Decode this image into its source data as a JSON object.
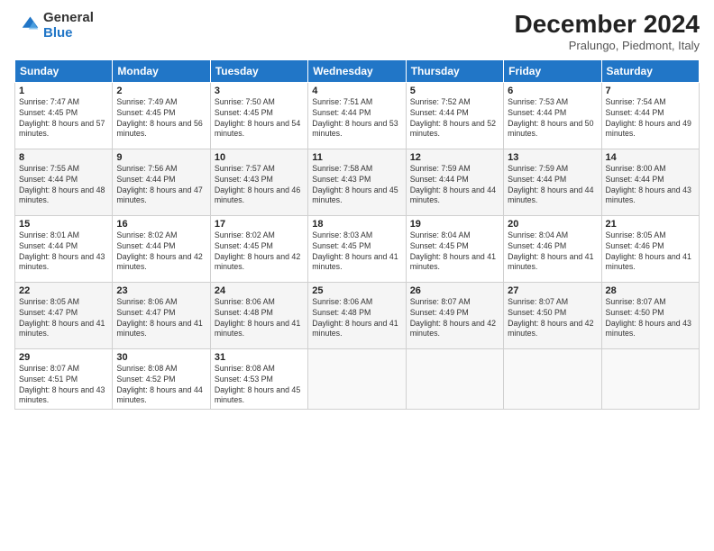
{
  "logo": {
    "general": "General",
    "blue": "Blue"
  },
  "header": {
    "month": "December 2024",
    "location": "Pralungo, Piedmont, Italy"
  },
  "weekdays": [
    "Sunday",
    "Monday",
    "Tuesday",
    "Wednesday",
    "Thursday",
    "Friday",
    "Saturday"
  ],
  "weeks": [
    [
      {
        "day": "1",
        "sunrise": "7:47 AM",
        "sunset": "4:45 PM",
        "daylight": "8 hours and 57 minutes."
      },
      {
        "day": "2",
        "sunrise": "7:49 AM",
        "sunset": "4:45 PM",
        "daylight": "8 hours and 56 minutes."
      },
      {
        "day": "3",
        "sunrise": "7:50 AM",
        "sunset": "4:45 PM",
        "daylight": "8 hours and 54 minutes."
      },
      {
        "day": "4",
        "sunrise": "7:51 AM",
        "sunset": "4:44 PM",
        "daylight": "8 hours and 53 minutes."
      },
      {
        "day": "5",
        "sunrise": "7:52 AM",
        "sunset": "4:44 PM",
        "daylight": "8 hours and 52 minutes."
      },
      {
        "day": "6",
        "sunrise": "7:53 AM",
        "sunset": "4:44 PM",
        "daylight": "8 hours and 50 minutes."
      },
      {
        "day": "7",
        "sunrise": "7:54 AM",
        "sunset": "4:44 PM",
        "daylight": "8 hours and 49 minutes."
      }
    ],
    [
      {
        "day": "8",
        "sunrise": "7:55 AM",
        "sunset": "4:44 PM",
        "daylight": "8 hours and 48 minutes."
      },
      {
        "day": "9",
        "sunrise": "7:56 AM",
        "sunset": "4:44 PM",
        "daylight": "8 hours and 47 minutes."
      },
      {
        "day": "10",
        "sunrise": "7:57 AM",
        "sunset": "4:43 PM",
        "daylight": "8 hours and 46 minutes."
      },
      {
        "day": "11",
        "sunrise": "7:58 AM",
        "sunset": "4:43 PM",
        "daylight": "8 hours and 45 minutes."
      },
      {
        "day": "12",
        "sunrise": "7:59 AM",
        "sunset": "4:44 PM",
        "daylight": "8 hours and 44 minutes."
      },
      {
        "day": "13",
        "sunrise": "7:59 AM",
        "sunset": "4:44 PM",
        "daylight": "8 hours and 44 minutes."
      },
      {
        "day": "14",
        "sunrise": "8:00 AM",
        "sunset": "4:44 PM",
        "daylight": "8 hours and 43 minutes."
      }
    ],
    [
      {
        "day": "15",
        "sunrise": "8:01 AM",
        "sunset": "4:44 PM",
        "daylight": "8 hours and 43 minutes."
      },
      {
        "day": "16",
        "sunrise": "8:02 AM",
        "sunset": "4:44 PM",
        "daylight": "8 hours and 42 minutes."
      },
      {
        "day": "17",
        "sunrise": "8:02 AM",
        "sunset": "4:45 PM",
        "daylight": "8 hours and 42 minutes."
      },
      {
        "day": "18",
        "sunrise": "8:03 AM",
        "sunset": "4:45 PM",
        "daylight": "8 hours and 41 minutes."
      },
      {
        "day": "19",
        "sunrise": "8:04 AM",
        "sunset": "4:45 PM",
        "daylight": "8 hours and 41 minutes."
      },
      {
        "day": "20",
        "sunrise": "8:04 AM",
        "sunset": "4:46 PM",
        "daylight": "8 hours and 41 minutes."
      },
      {
        "day": "21",
        "sunrise": "8:05 AM",
        "sunset": "4:46 PM",
        "daylight": "8 hours and 41 minutes."
      }
    ],
    [
      {
        "day": "22",
        "sunrise": "8:05 AM",
        "sunset": "4:47 PM",
        "daylight": "8 hours and 41 minutes."
      },
      {
        "day": "23",
        "sunrise": "8:06 AM",
        "sunset": "4:47 PM",
        "daylight": "8 hours and 41 minutes."
      },
      {
        "day": "24",
        "sunrise": "8:06 AM",
        "sunset": "4:48 PM",
        "daylight": "8 hours and 41 minutes."
      },
      {
        "day": "25",
        "sunrise": "8:06 AM",
        "sunset": "4:48 PM",
        "daylight": "8 hours and 41 minutes."
      },
      {
        "day": "26",
        "sunrise": "8:07 AM",
        "sunset": "4:49 PM",
        "daylight": "8 hours and 42 minutes."
      },
      {
        "day": "27",
        "sunrise": "8:07 AM",
        "sunset": "4:50 PM",
        "daylight": "8 hours and 42 minutes."
      },
      {
        "day": "28",
        "sunrise": "8:07 AM",
        "sunset": "4:50 PM",
        "daylight": "8 hours and 43 minutes."
      }
    ],
    [
      {
        "day": "29",
        "sunrise": "8:07 AM",
        "sunset": "4:51 PM",
        "daylight": "8 hours and 43 minutes."
      },
      {
        "day": "30",
        "sunrise": "8:08 AM",
        "sunset": "4:52 PM",
        "daylight": "8 hours and 44 minutes."
      },
      {
        "day": "31",
        "sunrise": "8:08 AM",
        "sunset": "4:53 PM",
        "daylight": "8 hours and 45 minutes."
      },
      null,
      null,
      null,
      null
    ]
  ],
  "labels": {
    "sunrise": "Sunrise: ",
    "sunset": "Sunset: ",
    "daylight": "Daylight: "
  }
}
